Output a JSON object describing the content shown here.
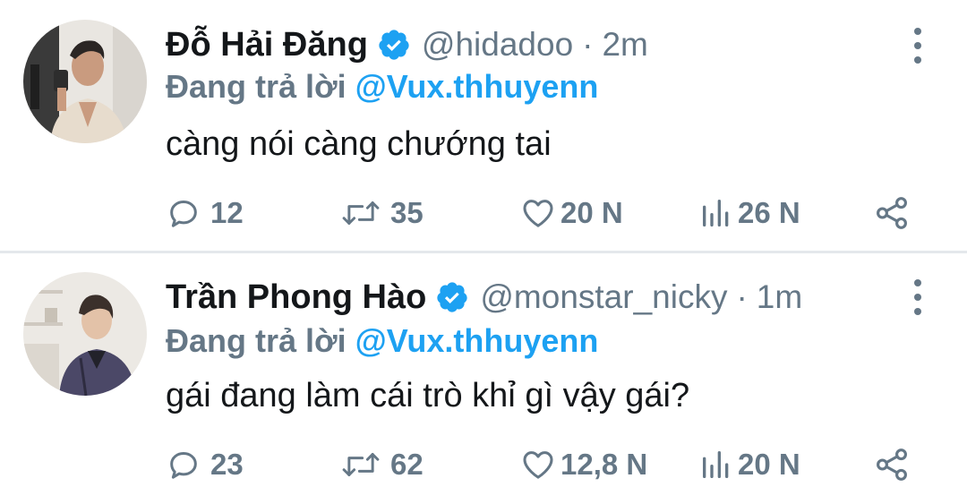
{
  "tweets": [
    {
      "name": "Đỗ Hải Đăng",
      "handle": "@hidadoo",
      "separator": "·",
      "time": "2m",
      "replying_prefix": "Đang trả lời",
      "replying_to": "@Vux.thhuyenn",
      "text": "càng nói càng chướng tai",
      "replies": "12",
      "retweets": "35",
      "likes": "20 N",
      "views": "26 N",
      "verified": true
    },
    {
      "name": "Trần Phong Hào",
      "handle": "@monstar_nicky",
      "separator": "·",
      "time": "1m",
      "replying_prefix": "Đang trả lời",
      "replying_to": "@Vux.thhuyenn",
      "text": "gái đang làm cái trò khỉ gì vậy gái?",
      "replies": "23",
      "retweets": "62",
      "likes": "12,8 N",
      "views": "20 N",
      "verified": true
    }
  ],
  "icons": {
    "verified": "verified-badge-icon",
    "more": "more-vertical-icon",
    "reply": "reply-icon",
    "retweet": "retweet-icon",
    "like": "heart-icon",
    "views": "views-chart-icon",
    "share": "share-icon"
  },
  "colors": {
    "accent": "#1da1f2",
    "text": "#14171a",
    "secondary": "#657786",
    "divider": "#e4e8eb"
  }
}
